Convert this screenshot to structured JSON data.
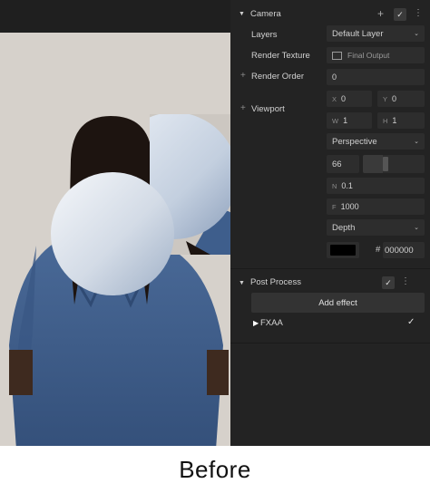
{
  "panel": {
    "camera": {
      "title": "Camera",
      "add_symbol": "+",
      "check_symbol": "✓",
      "more_symbol": "⋮",
      "layers_label": "Layers",
      "layers_value": "Default Layer",
      "render_texture_label": "Render Texture",
      "render_texture_value": "Final Output",
      "render_order_label": "Render Order",
      "render_order_value": "0",
      "viewport_label": "Viewport",
      "viewport_x_label": "X",
      "viewport_x": "0",
      "viewport_y_label": "Y",
      "viewport_y": "0",
      "viewport_w_label": "W",
      "viewport_w": "1",
      "viewport_h_label": "H",
      "viewport_h": "1",
      "projection": "Perspective",
      "fov": "66",
      "near_label": "N",
      "near": "0.1",
      "far_label": "F",
      "far": "1000",
      "clear_mode": "Depth",
      "clear_color_hash": "#",
      "clear_color": "000000"
    },
    "post_process": {
      "title": "Post Process",
      "check_symbol": "✓",
      "more_symbol": "⋮",
      "add_effect_label": "Add effect",
      "effects": [
        {
          "name": "FXAA",
          "enabled_symbol": "✓"
        }
      ]
    }
  },
  "caption": "Before",
  "colors": {
    "panel_bg": "#232323",
    "field_bg": "#2d2d2d",
    "viewport_bg": "#d6d1cb",
    "shirt": "#3f5f8c"
  }
}
